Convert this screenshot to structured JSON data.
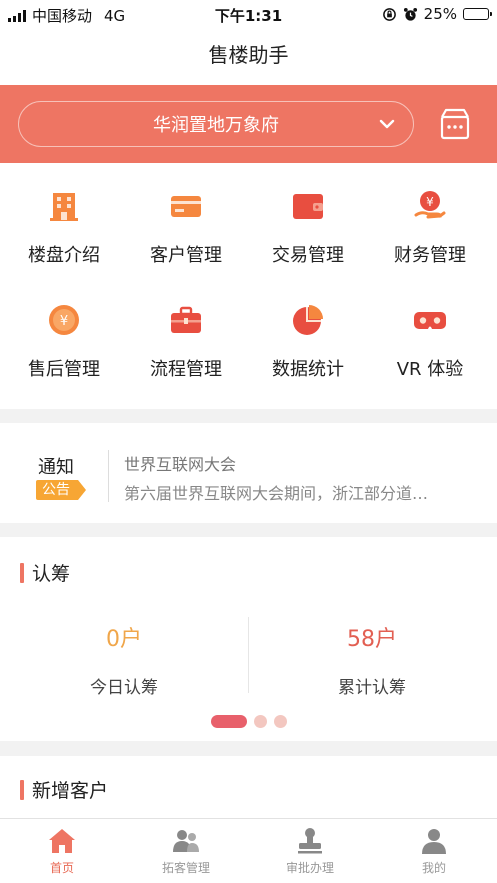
{
  "status_bar": {
    "carrier": "中国移动",
    "network": "4G",
    "time": "下午1:31",
    "battery": "25%",
    "battery_level": 0.25
  },
  "header": {
    "title": "售楼助手"
  },
  "project_selector": {
    "name": "华润置地万象府"
  },
  "menu": [
    {
      "label": "楼盘介绍",
      "icon": "building-icon"
    },
    {
      "label": "客户管理",
      "icon": "card-icon"
    },
    {
      "label": "交易管理",
      "icon": "wallet-icon"
    },
    {
      "label": "财务管理",
      "icon": "money-hand-icon"
    },
    {
      "label": "售后管理",
      "icon": "yuan-coin-icon"
    },
    {
      "label": "流程管理",
      "icon": "briefcase-icon"
    },
    {
      "label": "数据统计",
      "icon": "pie-chart-icon"
    },
    {
      "label": "VR 体验",
      "icon": "vr-glasses-icon"
    }
  ],
  "notice": {
    "title": "通知",
    "badge": "公告",
    "headline": "世界互联网大会",
    "summary": "第六届世界互联网大会期间，浙江部分道…"
  },
  "subscription": {
    "title": "认筹",
    "today": {
      "value": "0户",
      "label": "今日认筹"
    },
    "total": {
      "value": "58户",
      "label": "累计认筹"
    },
    "pager": {
      "count": 3,
      "active": 1
    }
  },
  "new_customers": {
    "title": "新增客户"
  },
  "tabs": [
    {
      "label": "首页",
      "icon": "home-icon",
      "active": true
    },
    {
      "label": "拓客管理",
      "icon": "users-icon",
      "active": false
    },
    {
      "label": "审批办理",
      "icon": "stamp-icon",
      "active": false
    },
    {
      "label": "我的",
      "icon": "person-icon",
      "active": false
    }
  ],
  "colors": {
    "accent": "#ee7563",
    "icon_orange": "#f5873f",
    "icon_red": "#e84e40",
    "badge": "#f7a634",
    "today_value": "#f0a64a",
    "total_value": "#e25f52"
  }
}
